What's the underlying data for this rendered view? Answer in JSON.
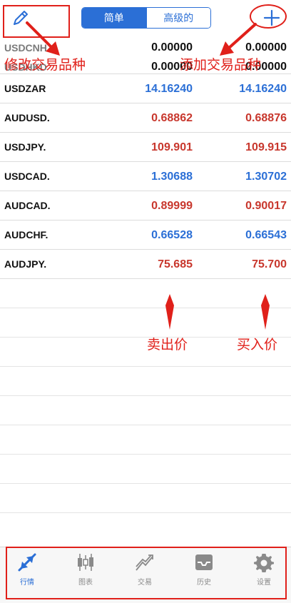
{
  "header": {
    "segments": [
      {
        "label": "简单",
        "active": true
      },
      {
        "label": "高级的",
        "active": false
      }
    ]
  },
  "quotes": [
    {
      "symbol": "USDCNH",
      "bid": "0.00000",
      "ask": "0.00000",
      "trend": "flat",
      "muted": true
    },
    {
      "symbol": "USDHKD",
      "bid": "0.00000",
      "ask": "0.00000",
      "trend": "flat",
      "muted": true
    },
    {
      "symbol": "USDZAR",
      "bid": "14.16240",
      "ask": "14.16240",
      "trend": "up",
      "muted": false
    },
    {
      "symbol": "AUDUSD.",
      "bid": "0.68862",
      "ask": "0.68876",
      "trend": "down",
      "muted": false
    },
    {
      "symbol": "USDJPY.",
      "bid": "109.901",
      "ask": "109.915",
      "trend": "down",
      "muted": false
    },
    {
      "symbol": "USDCAD.",
      "bid": "1.30688",
      "ask": "1.30702",
      "trend": "up",
      "muted": false
    },
    {
      "symbol": "AUDCAD.",
      "bid": "0.89999",
      "ask": "0.90017",
      "trend": "down",
      "muted": false
    },
    {
      "symbol": "AUDCHF.",
      "bid": "0.66528",
      "ask": "0.66543",
      "trend": "up",
      "muted": false
    },
    {
      "symbol": "AUDJPY.",
      "bid": "75.685",
      "ask": "75.700",
      "trend": "down",
      "muted": false
    }
  ],
  "annotations": {
    "edit": "修改交易品种",
    "add": "添加交易品种",
    "sell_price": "卖出价",
    "buy_price": "买入价"
  },
  "tabs": [
    {
      "label": "行情",
      "icon": "quotes-icon",
      "active": true
    },
    {
      "label": "图表",
      "icon": "chart-icon",
      "active": false
    },
    {
      "label": "交易",
      "icon": "trade-icon",
      "active": false
    },
    {
      "label": "历史",
      "icon": "history-icon",
      "active": false
    },
    {
      "label": "设置",
      "icon": "gear-icon",
      "active": false
    }
  ],
  "colors": {
    "accent": "#2b6fd6",
    "price_up": "#2b6fd6",
    "price_down": "#c8372d",
    "annotation": "#e0201a"
  }
}
